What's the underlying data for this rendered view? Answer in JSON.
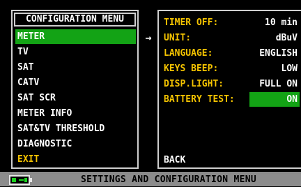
{
  "left_menu": {
    "header": "CONFIGURATION MENU",
    "items": [
      {
        "label": "METER",
        "selected": true
      },
      {
        "label": "TV"
      },
      {
        "label": "SAT"
      },
      {
        "label": "CATV"
      },
      {
        "label": "SAT SCR"
      },
      {
        "label": "METER INFO"
      },
      {
        "label": "SAT&TV THRESHOLD"
      },
      {
        "label": "DIAGNOSTIC"
      },
      {
        "label": "EXIT"
      }
    ]
  },
  "arrow_icon": "right-arrow-icon",
  "settings": {
    "rows": [
      {
        "label": "TIMER OFF:",
        "value": "10 min"
      },
      {
        "label": "UNIT:",
        "value": "dBuV"
      },
      {
        "label": "LANGUAGE:",
        "value": "ENGLISH"
      },
      {
        "label": "KEYS BEEP:",
        "value": "LOW"
      },
      {
        "label": "DISP.LIGHT:",
        "value": "FULL ON"
      },
      {
        "label": "BATTERY TEST:",
        "value": "ON",
        "active": true
      }
    ],
    "back_label": "BACK"
  },
  "status_bar": {
    "battery_icon": "battery-charging-icon",
    "text": "SETTINGS AND CONFIGURATION MENU"
  },
  "colors": {
    "highlight": "#13a315",
    "label_yellow": "#f5c400",
    "status_bar": "#8c8c8c"
  }
}
